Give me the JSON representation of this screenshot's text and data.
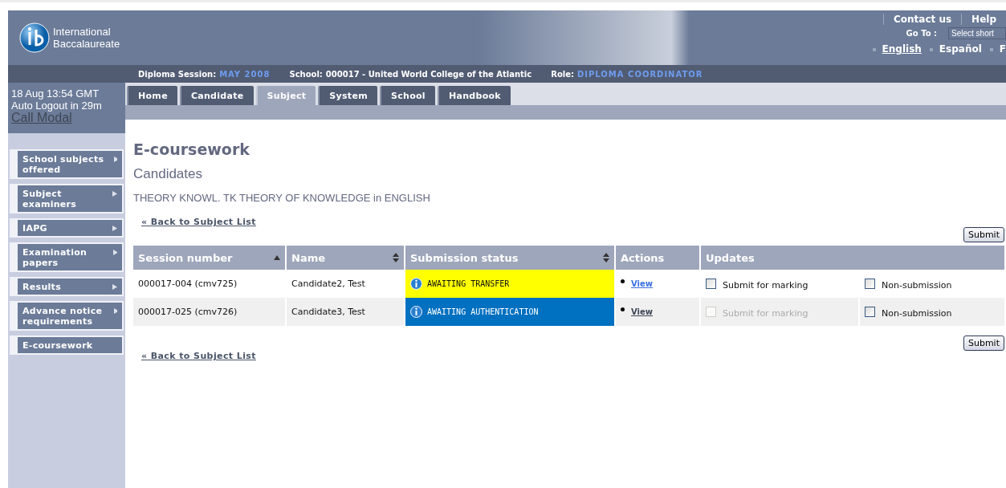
{
  "header": {
    "logo_text": [
      "International",
      "Baccalaureate"
    ],
    "links": [
      "Contact us",
      "Help"
    ],
    "goto_label": "Go To :",
    "goto_placeholder": "Select short",
    "languages": [
      {
        "label": "English",
        "selected": true
      },
      {
        "label": "Español",
        "selected": false
      },
      {
        "label": "F",
        "selected": false
      }
    ]
  },
  "info_bar": [
    {
      "label": "Diploma Session:",
      "value": "MAY 2008",
      "kind": "highlight"
    },
    {
      "label": "School:",
      "value": "000017 - United World College of the Atlantic",
      "kind": "plain"
    },
    {
      "label": "Role:",
      "value": "DIPLOMA COORDINATOR",
      "kind": "highlight"
    }
  ],
  "clock": {
    "time": "18 Aug 13:54 GMT",
    "logout": "Auto Logout in 29m",
    "link": "Call Modal"
  },
  "tabs": [
    {
      "label": "Home",
      "selected": false
    },
    {
      "label": "Candidate",
      "selected": false
    },
    {
      "label": "Subject",
      "selected": true
    },
    {
      "label": "System",
      "selected": false
    },
    {
      "label": "School",
      "selected": false
    },
    {
      "label": "Handbook",
      "selected": false
    }
  ],
  "sidebar": {
    "items": [
      {
        "label": "School subjects offered",
        "arrow": true
      },
      {
        "label": "Subject examiners",
        "arrow": true
      },
      {
        "label": "IAPG",
        "arrow": true
      },
      {
        "label": "Examination papers",
        "arrow": true
      },
      {
        "label": "Results",
        "arrow": true
      },
      {
        "label": "Advance notice requirements",
        "arrow": true
      },
      {
        "label": "E-coursework",
        "arrow": false
      }
    ]
  },
  "page": {
    "title": "E-coursework",
    "subtitle": "Candidates",
    "subject": "THEORY KNOWL. TK THEORY OF KNOWLEDGE in ENGLISH",
    "back_link_top": "« Back to Subject List",
    "back_link_bottom": "« Back to Subject List",
    "submit_top": "Submit",
    "submit_bottom": "Submit"
  },
  "table": {
    "columns": [
      {
        "label": "Session number",
        "sortable": true,
        "sorted": true
      },
      {
        "label": "Name",
        "sortable": true,
        "sorted": false
      },
      {
        "label": "Submission status",
        "sortable": true,
        "sorted": false
      },
      {
        "label": "Actions",
        "sortable": false,
        "sorted": false
      },
      {
        "label": "Updates",
        "sortable": false,
        "sorted": false
      }
    ],
    "rows": [
      {
        "session": "000017-004 (cmv725)",
        "name": "Candidate2, Test",
        "status": "AWAITING TRANSFER",
        "color": "#ffff00",
        "action": "View",
        "visited": false,
        "submit": {
          "label": "Submit for marking",
          "checked": false,
          "disabled": false
        },
        "nonsub": {
          "label": "Non-submission",
          "checked": false,
          "disabled": false
        }
      },
      {
        "session": "000017-025 (cmv726)",
        "name": "Candidate3, Test",
        "status": "AWAITING AUTHENTICATION",
        "color": "#0070c0",
        "action": "View",
        "visited": true,
        "submit": {
          "label": "Submit for marking",
          "checked": false,
          "disabled": true
        },
        "nonsub": {
          "label": "Non-submission",
          "checked": false,
          "disabled": false
        }
      }
    ]
  }
}
